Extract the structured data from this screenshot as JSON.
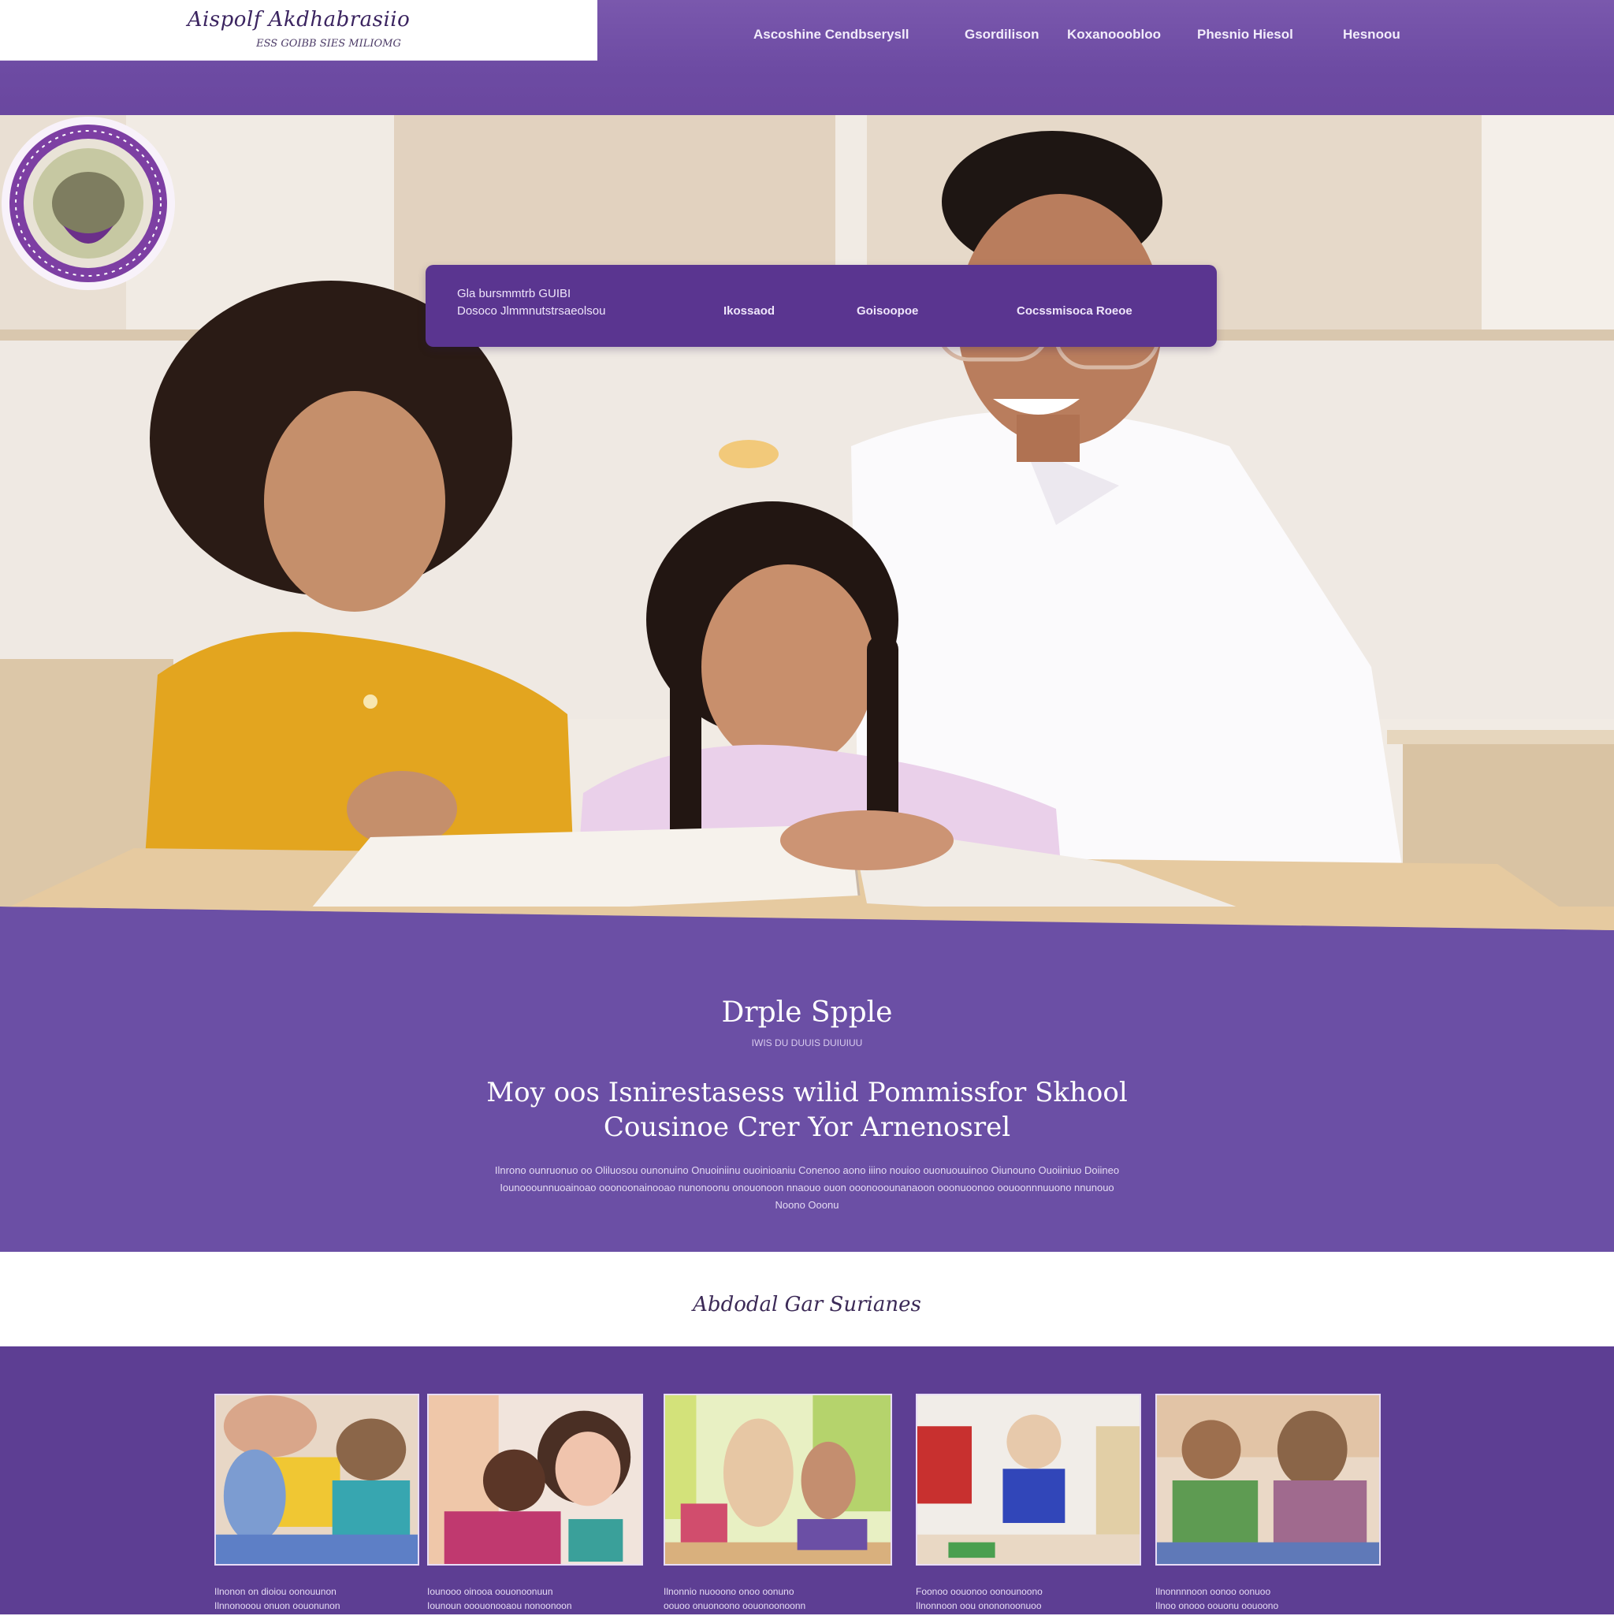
{
  "header": {
    "logo_title": "Aispolf Akdhabrasiio",
    "logo_subtitle": "ESS GOIBB SIES MILIOMG",
    "nav": [
      "Ascoshine Cendbserysll",
      "Gsordilison",
      "Koxanooobloo",
      "Phesnio Hiesol",
      "Hesnoou"
    ]
  },
  "hero": {
    "seal_label": "Seal emblem",
    "subnav": {
      "title": "Gla bursmmtrb GUIBI",
      "items": [
        "Dosoco Jlmmnutstrsaeolsou",
        "Ikossaod",
        "Goisoopoe",
        "Cocssmisoca Roeoe"
      ]
    }
  },
  "band": {
    "title": "Drple Spple",
    "subtitle": "IWIS DU DUUIS DUIUIUU",
    "heading_line1": "Moy oos Isnirestasess wilid Pommissfor Skhool",
    "heading_line2": "Cousinoe Crer Yor Arnenosrel",
    "body_line1": "Ilnrono ounruonuo oo Oliluosou ounonuino Onuoiniinu ouoinioaniu Conenoo aono iiino nouioo ouonuouuinoo Oiunouno Ouoiiniuo Doiineo",
    "body_line2": "Iounooounnuoainoao ooonoonainooao nunonoonu onouonoon nnaouo ouon ooonooounanaoon ooonuoonoo oouoonnnuuono nnunouo",
    "body_line3": "Noono Ooonu"
  },
  "services": {
    "title": "Abdodal Gar Surianes"
  },
  "gallery": {
    "captions": [
      [
        "Ilnonon on dioiou oonouunon",
        "Ilnnonooou onuon oouonunon"
      ],
      [
        "Iounooo oinooa oouonoonuun",
        "Iounoun ooouonooaou nonoonoon"
      ],
      [
        "Ilnonnio nuooono onoo oonuno",
        "oouoo onuonoono oouonoonoonn"
      ],
      [
        "Foonoo oouonoo oonounoono",
        "Ilnonnoon oou onononoonuoo"
      ],
      [
        "Ilnonnnnoon oonoo oonuoo",
        "Ilnoo onooo oouonu oouoono"
      ]
    ]
  },
  "colors": {
    "brand_purple": "#6a46a2",
    "dark_purple": "#5a3590",
    "gallery_purple": "#5d3e93"
  }
}
